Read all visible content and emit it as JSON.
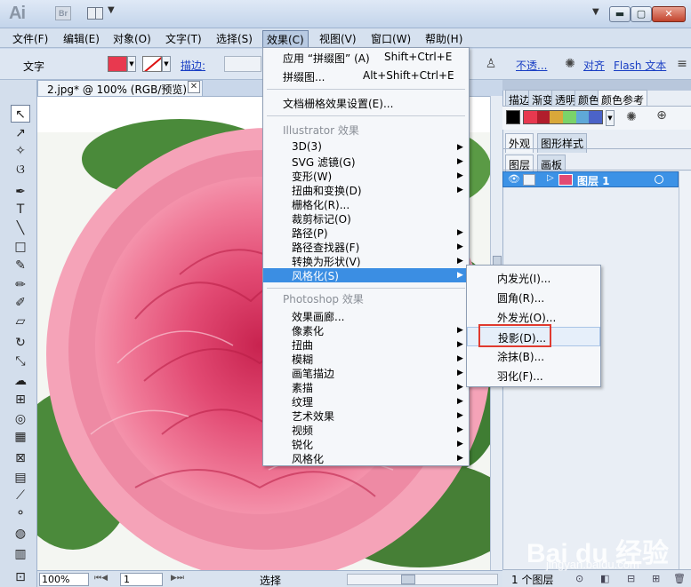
{
  "app": {
    "logo": "Ai",
    "bridge_logo": "Br"
  },
  "menubar": {
    "items": [
      "文件(F)",
      "编辑(E)",
      "对象(O)",
      "文字(T)",
      "选择(S)",
      "效果(C)",
      "视图(V)",
      "窗口(W)",
      "帮助(H)"
    ],
    "active": "效果(C)"
  },
  "controlbar": {
    "label": "文字",
    "stroke_label": "描边:",
    "opacity_link": "不透...",
    "align_link": "对齐",
    "flash_link": "Flash 文本",
    "fill_color": "#e8394f"
  },
  "document": {
    "tab_title": "2.jpg* @ 100% (RGB/预览)",
    "close_glyph": "✕"
  },
  "statusbar": {
    "zoom": "100%",
    "page": "1",
    "status_text": "选择"
  },
  "effect_menu": {
    "top_items": [
      {
        "label": "应用 “拼缀图” (A)",
        "shortcut": "Shift+Ctrl+E"
      },
      {
        "label": "拼缀图...",
        "shortcut": "Alt+Shift+Ctrl+E"
      }
    ],
    "document_raster": "文档栅格效果设置(E)...",
    "illustrator_heading": "Illustrator 效果",
    "illustrator_items": [
      {
        "label": "3D(3)",
        "submenu": true
      },
      {
        "label": "SVG 滤镜(G)",
        "submenu": true
      },
      {
        "label": "变形(W)",
        "submenu": true
      },
      {
        "label": "扭曲和变换(D)",
        "submenu": true
      },
      {
        "label": "栅格化(R)...",
        "submenu": false
      },
      {
        "label": "裁剪标记(O)",
        "submenu": false
      },
      {
        "label": "路径(P)",
        "submenu": true
      },
      {
        "label": "路径查找器(F)",
        "submenu": true
      },
      {
        "label": "转换为形状(V)",
        "submenu": true
      },
      {
        "label": "风格化(S)",
        "submenu": true,
        "highlighted": true
      }
    ],
    "photoshop_heading": "Photoshop 效果",
    "photoshop_items": [
      {
        "label": "效果画廊...",
        "submenu": false
      },
      {
        "label": "像素化",
        "submenu": true
      },
      {
        "label": "扭曲",
        "submenu": true
      },
      {
        "label": "模糊",
        "submenu": true
      },
      {
        "label": "画笔描边",
        "submenu": true
      },
      {
        "label": "素描",
        "submenu": true
      },
      {
        "label": "纹理",
        "submenu": true
      },
      {
        "label": "艺术效果",
        "submenu": true
      },
      {
        "label": "视频",
        "submenu": true
      },
      {
        "label": "锐化",
        "submenu": true
      },
      {
        "label": "风格化",
        "submenu": true
      }
    ]
  },
  "stylize_submenu": {
    "items": [
      "内发光(I)...",
      "圆角(R)...",
      "外发光(O)...",
      "投影(D)...",
      "涂抹(B)...",
      "羽化(F)..."
    ],
    "hovered": "投影(D)..."
  },
  "panels": {
    "top_tabs": [
      "描边",
      "渐变",
      "透明",
      "颜色",
      "颜色参考"
    ],
    "appearance_tabs": [
      "外观",
      "图形样式"
    ],
    "layers_tabs": [
      "图层",
      "画板"
    ],
    "layer_name": "图层 1",
    "footer_text": "1 个图层",
    "guide_colors": [
      "#e8394f",
      "#b11d2c",
      "#d9a83a",
      "#7ad36a",
      "#5fa8d8",
      "#4b63c8"
    ]
  },
  "watermark": {
    "logo": "Bai du 经验",
    "sub": "jingyan.baidu.com"
  }
}
